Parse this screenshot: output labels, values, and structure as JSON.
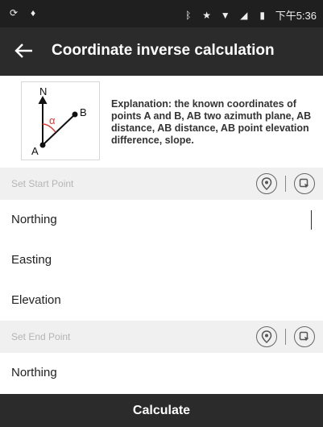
{
  "status_bar": {
    "time": "下午5:36",
    "left_icons": [
      "sync-icon",
      "location-pin-icon"
    ],
    "right_icons": [
      "bluetooth-icon",
      "star-icon",
      "wifi-icon",
      "signal-icon",
      "battery-icon"
    ]
  },
  "app_bar": {
    "title": "Coordinate inverse calculation"
  },
  "explanation": {
    "text": "Explanation: the known coordinates of points A and B, AB two azimuth plane, AB distance, AB distance, AB point elevation difference, slope.",
    "diagram": {
      "north_label": "N",
      "point_a": "A",
      "point_b": "B",
      "angle_label": "α"
    }
  },
  "start_point": {
    "header": "Set Start Point",
    "fields": [
      {
        "label": "Northing",
        "value": ""
      },
      {
        "label": "Easting",
        "value": ""
      },
      {
        "label": "Elevation",
        "value": ""
      }
    ]
  },
  "end_point": {
    "header": "Set End Point",
    "fields": [
      {
        "label": "Northing",
        "value": ""
      }
    ]
  },
  "calculate_label": "Calculate",
  "colors": {
    "app_bar": "#2b2b2b",
    "status_bar": "#1f1f1f",
    "section_bg": "#f0f0f0",
    "angle_red": "#e53935"
  }
}
